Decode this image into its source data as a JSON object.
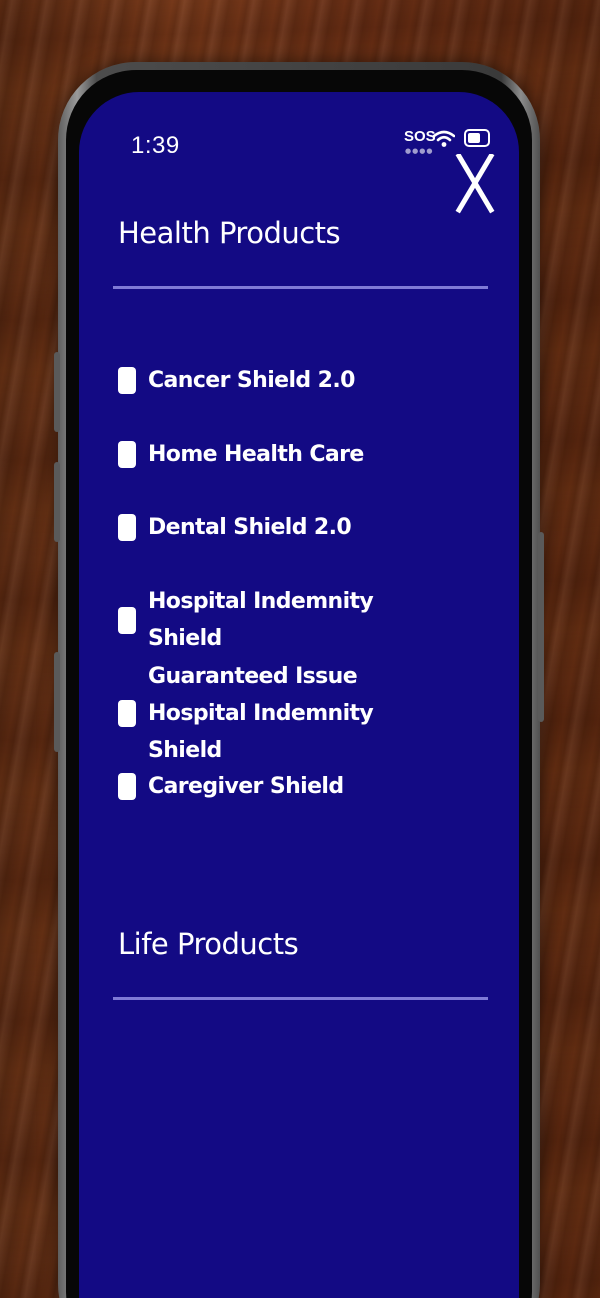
{
  "status_bar": {
    "time": "1:39",
    "carrier": "SOS",
    "icons": [
      "wifi-icon",
      "battery-icon"
    ]
  },
  "close_button": {
    "icon": "close-icon",
    "label": "X"
  },
  "sections": [
    {
      "title": "Health Products",
      "items": [
        {
          "label": "Cancer Shield 2.0",
          "checked": false
        },
        {
          "label": "Home Health Care",
          "checked": false
        },
        {
          "label": "Dental Shield 2.0",
          "checked": false
        },
        {
          "label": "Hospital Indemnity Shield",
          "checked": false
        },
        {
          "label": "Guaranteed Issue Hospital Indemnity Shield",
          "checked": false
        },
        {
          "label": "Caregiver Shield",
          "checked": false
        }
      ]
    },
    {
      "title": "Life Products",
      "items": []
    }
  ],
  "colors": {
    "screen_background": "#130a84",
    "divider": "#7f7ad6",
    "text": "#ffffff"
  }
}
